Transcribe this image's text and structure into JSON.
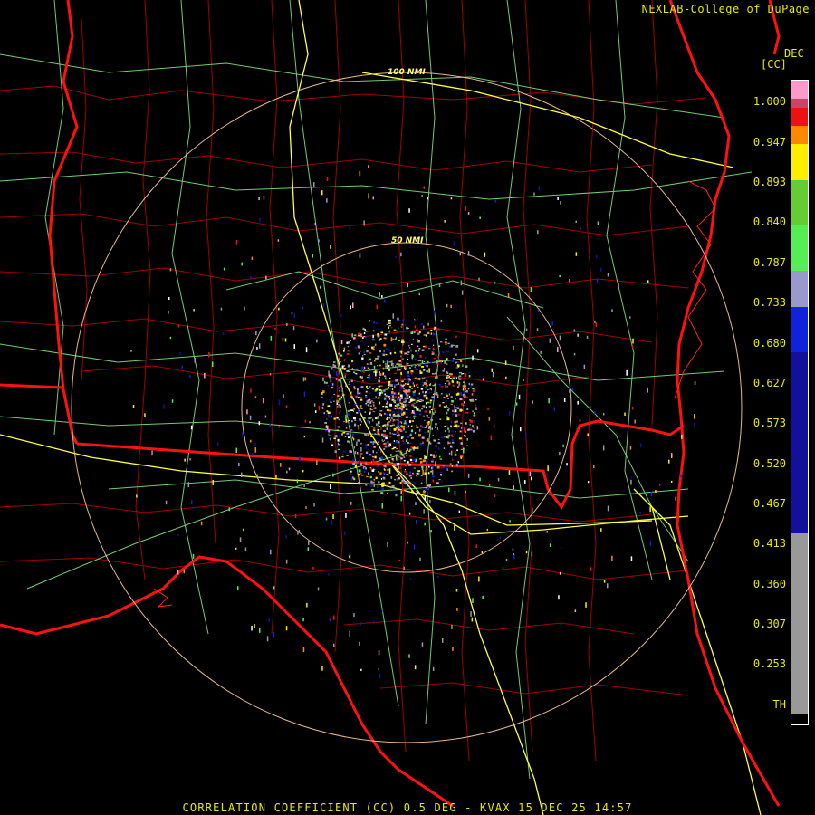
{
  "header": {
    "credit": "NEXLAB-College of DuPage"
  },
  "legend": {
    "title_line1": "DEC",
    "title_line2": "[CC]",
    "ticks": [
      "1.000",
      "0.947",
      "0.893",
      "0.840",
      "0.787",
      "0.733",
      "0.680",
      "0.627",
      "0.573",
      "0.520",
      "0.467",
      "0.413",
      "0.360",
      "0.307",
      "0.253",
      "TH"
    ],
    "colors": {
      "pink": "#ff99cc",
      "rose": "#cc4466",
      "red": "#ee1111",
      "orange": "#ff8800",
      "yellow": "#ffee00",
      "green": "#66cc33",
      "lightgreen": "#55ee55",
      "lavender": "#9999cc",
      "blue": "#1122dd",
      "navy": "#111199",
      "gray": "#999999",
      "black": "#000000"
    }
  },
  "map": {
    "range_rings": [
      "100 NMI",
      "50 NMI"
    ],
    "colors": {
      "state_border": "#ff1111",
      "county_border": "#aa0000",
      "highway": "#ffff44",
      "road": "#88ee88",
      "range_ring": "#ffcc99"
    }
  },
  "footer": {
    "product_title": "CORRELATION COEFFICIENT (CC) 0.5 DEG - KVAX 15 DEC 25 14:57"
  }
}
